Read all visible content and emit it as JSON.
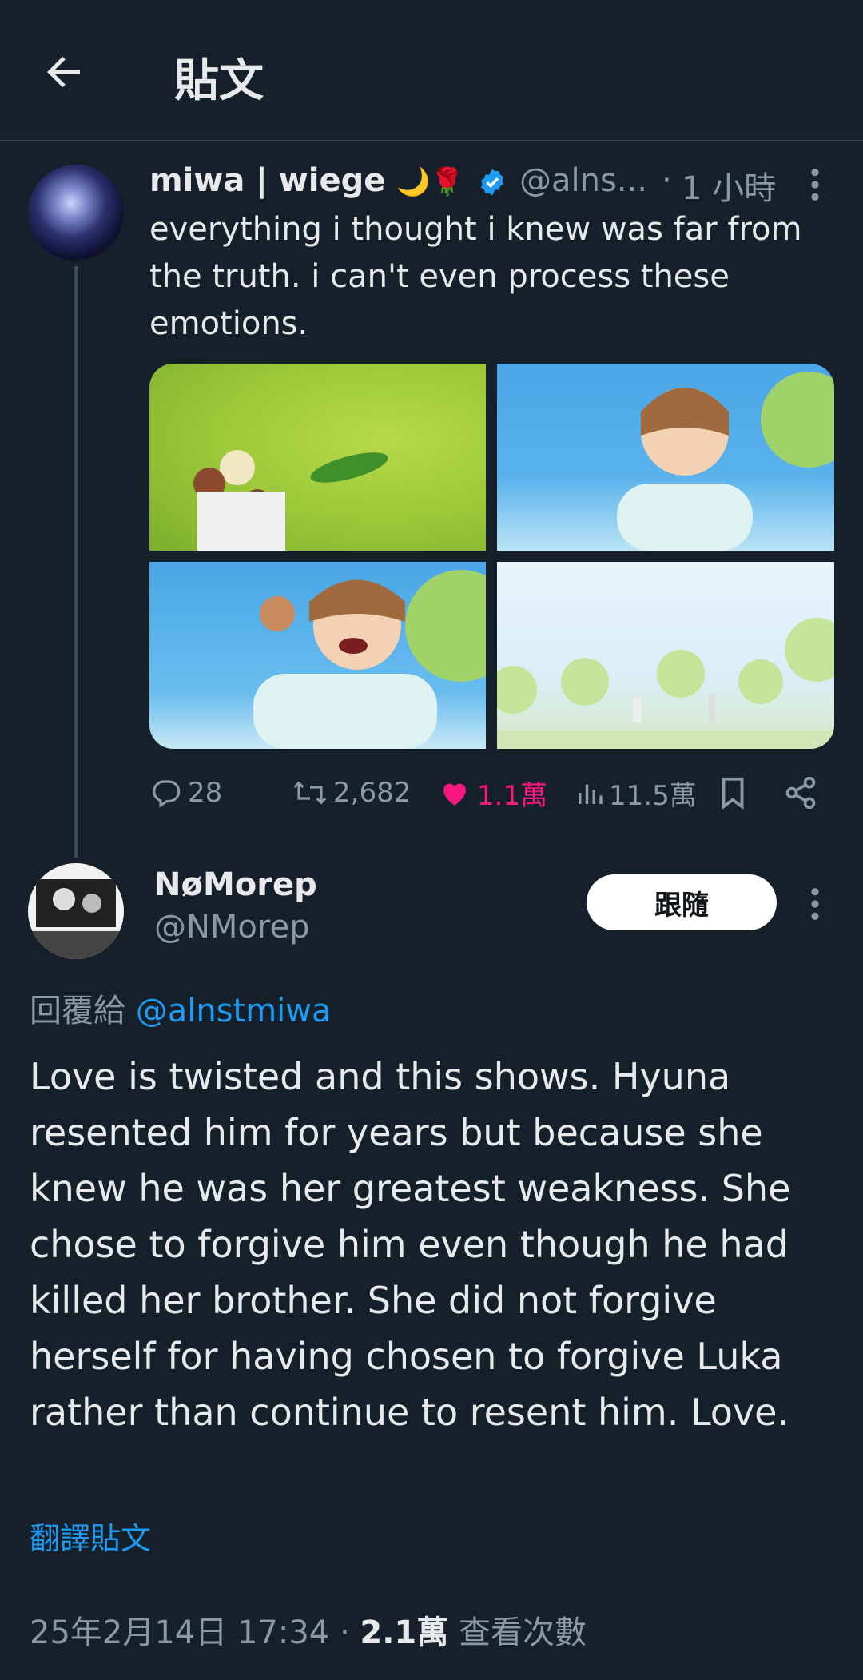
{
  "header": {
    "title": "貼文"
  },
  "tweet": {
    "name": "miwa | wiege",
    "name_emoji": "🌙🌹",
    "handle": "@alns...",
    "separator": "·",
    "time": "1 小時",
    "text": "everything i thought i knew was far from the truth. i can't even process these emotions.",
    "stats": {
      "replies": "28",
      "retweets": "2,682",
      "likes": "1.1萬",
      "views": "11.5萬"
    }
  },
  "reply": {
    "name": "NøMorep",
    "handle": "@NMorep",
    "follow_label": "跟隨",
    "reply_to_prefix": "回覆給",
    "reply_to_mention": "@alnstmiwa",
    "text": "Love is twisted and this shows. Hyuna resented him for years but because she knew he was her greatest weakness. She chose to forgive him even though he had killed her brother. She did not forgive herself for having chosen to forgive Luka rather than continue to resent him. Love.",
    "translate_label": "翻譯貼文",
    "timestamp": "25年2月14日 17:34",
    "meta_separator": "·",
    "views_count": "2.1萬",
    "views_label": "查看次數"
  },
  "colors": {
    "background": "#15202b",
    "accent": "#1d9bf0",
    "like": "#f91880",
    "muted": "#8b98a5"
  }
}
